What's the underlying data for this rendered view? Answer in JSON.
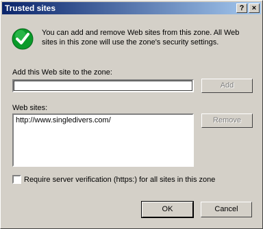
{
  "window": {
    "title": "Trusted sites",
    "help_label": "?",
    "close_label": "×"
  },
  "info": {
    "text": "You can add and remove Web sites from this zone. All Web sites in this zone will use the zone's security settings."
  },
  "add_section": {
    "label": "Add this Web site to the zone:",
    "value": "",
    "add_button": "Add"
  },
  "sites_section": {
    "label": "Web sites:",
    "items": [
      "http://www.singledivers.com/"
    ],
    "remove_button": "Remove"
  },
  "verification": {
    "label": "Require server verification (https:) for all sites in this zone",
    "checked": false
  },
  "buttons": {
    "ok": "OK",
    "cancel": "Cancel"
  },
  "colors": {
    "title_gradient_start": "#0a246a",
    "title_gradient_end": "#a6caf0",
    "check_icon": "#0a9a2a"
  }
}
